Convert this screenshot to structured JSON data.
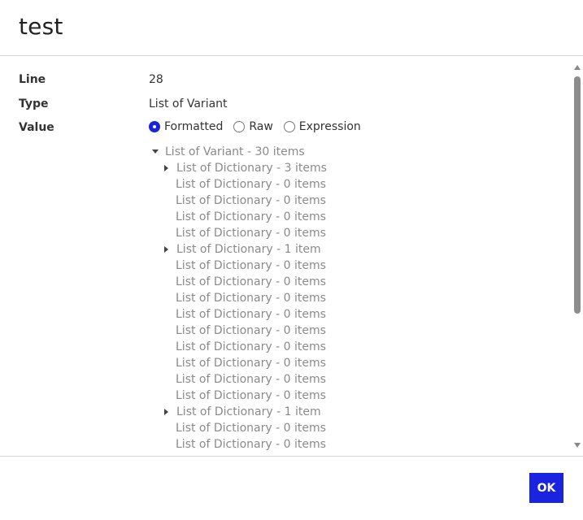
{
  "dialog": {
    "title": "test"
  },
  "fields": {
    "line": {
      "label": "Line",
      "value": "28"
    },
    "type": {
      "label": "Type",
      "value": "List of Variant"
    },
    "value": {
      "label": "Value",
      "options": [
        {
          "label": "Formatted",
          "selected": true
        },
        {
          "label": "Raw",
          "selected": false
        },
        {
          "label": "Expression",
          "selected": false
        }
      ]
    }
  },
  "tree": {
    "root": {
      "label": "List of Variant - 30 items",
      "expanded": true
    },
    "items": [
      {
        "label": "List of Dictionary - 3 items",
        "expandable": true
      },
      {
        "label": "List of Dictionary - 0 items",
        "expandable": false
      },
      {
        "label": "List of Dictionary - 0 items",
        "expandable": false
      },
      {
        "label": "List of Dictionary - 0 items",
        "expandable": false
      },
      {
        "label": "List of Dictionary - 0 items",
        "expandable": false
      },
      {
        "label": "List of Dictionary - 1 item",
        "expandable": true
      },
      {
        "label": "List of Dictionary - 0 items",
        "expandable": false
      },
      {
        "label": "List of Dictionary - 0 items",
        "expandable": false
      },
      {
        "label": "List of Dictionary - 0 items",
        "expandable": false
      },
      {
        "label": "List of Dictionary - 0 items",
        "expandable": false
      },
      {
        "label": "List of Dictionary - 0 items",
        "expandable": false
      },
      {
        "label": "List of Dictionary - 0 items",
        "expandable": false
      },
      {
        "label": "List of Dictionary - 0 items",
        "expandable": false
      },
      {
        "label": "List of Dictionary - 0 items",
        "expandable": false
      },
      {
        "label": "List of Dictionary - 0 items",
        "expandable": false
      },
      {
        "label": "List of Dictionary - 1 item",
        "expandable": true
      },
      {
        "label": "List of Dictionary - 0 items",
        "expandable": false
      },
      {
        "label": "List of Dictionary - 0 items",
        "expandable": false
      }
    ]
  },
  "footer": {
    "ok_label": "OK"
  },
  "colors": {
    "accent": "#1a23e0",
    "tree_text": "#8a8a8a",
    "scroll_thumb": "#8d8d8d"
  },
  "icons": {
    "expanded": "caret-down-icon",
    "collapsed": "caret-right-icon"
  }
}
